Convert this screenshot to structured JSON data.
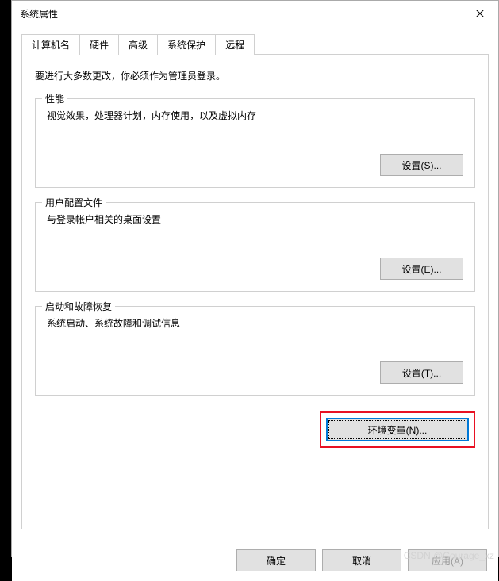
{
  "title": "系统属性",
  "tabs": [
    {
      "label": "计算机名"
    },
    {
      "label": "硬件"
    },
    {
      "label": "高级",
      "active": true
    },
    {
      "label": "系统保护"
    },
    {
      "label": "远程"
    }
  ],
  "instruction": "要进行大多数更改，你必须作为管理员登录。",
  "groups": {
    "performance": {
      "title": "性能",
      "desc": "视觉效果，处理器计划，内存使用，以及虚拟内存",
      "button": "设置(S)..."
    },
    "userProfiles": {
      "title": "用户配置文件",
      "desc": "与登录帐户相关的桌面设置",
      "button": "设置(E)..."
    },
    "startup": {
      "title": "启动和故障恢复",
      "desc": "系统启动、系统故障和调试信息",
      "button": "设置(T)..."
    }
  },
  "envVarButton": "环境变量(N)...",
  "dialogButtons": {
    "ok": "确定",
    "cancel": "取消",
    "apply": "应用(A)"
  },
  "watermark": "CSDN @Courage_xz"
}
